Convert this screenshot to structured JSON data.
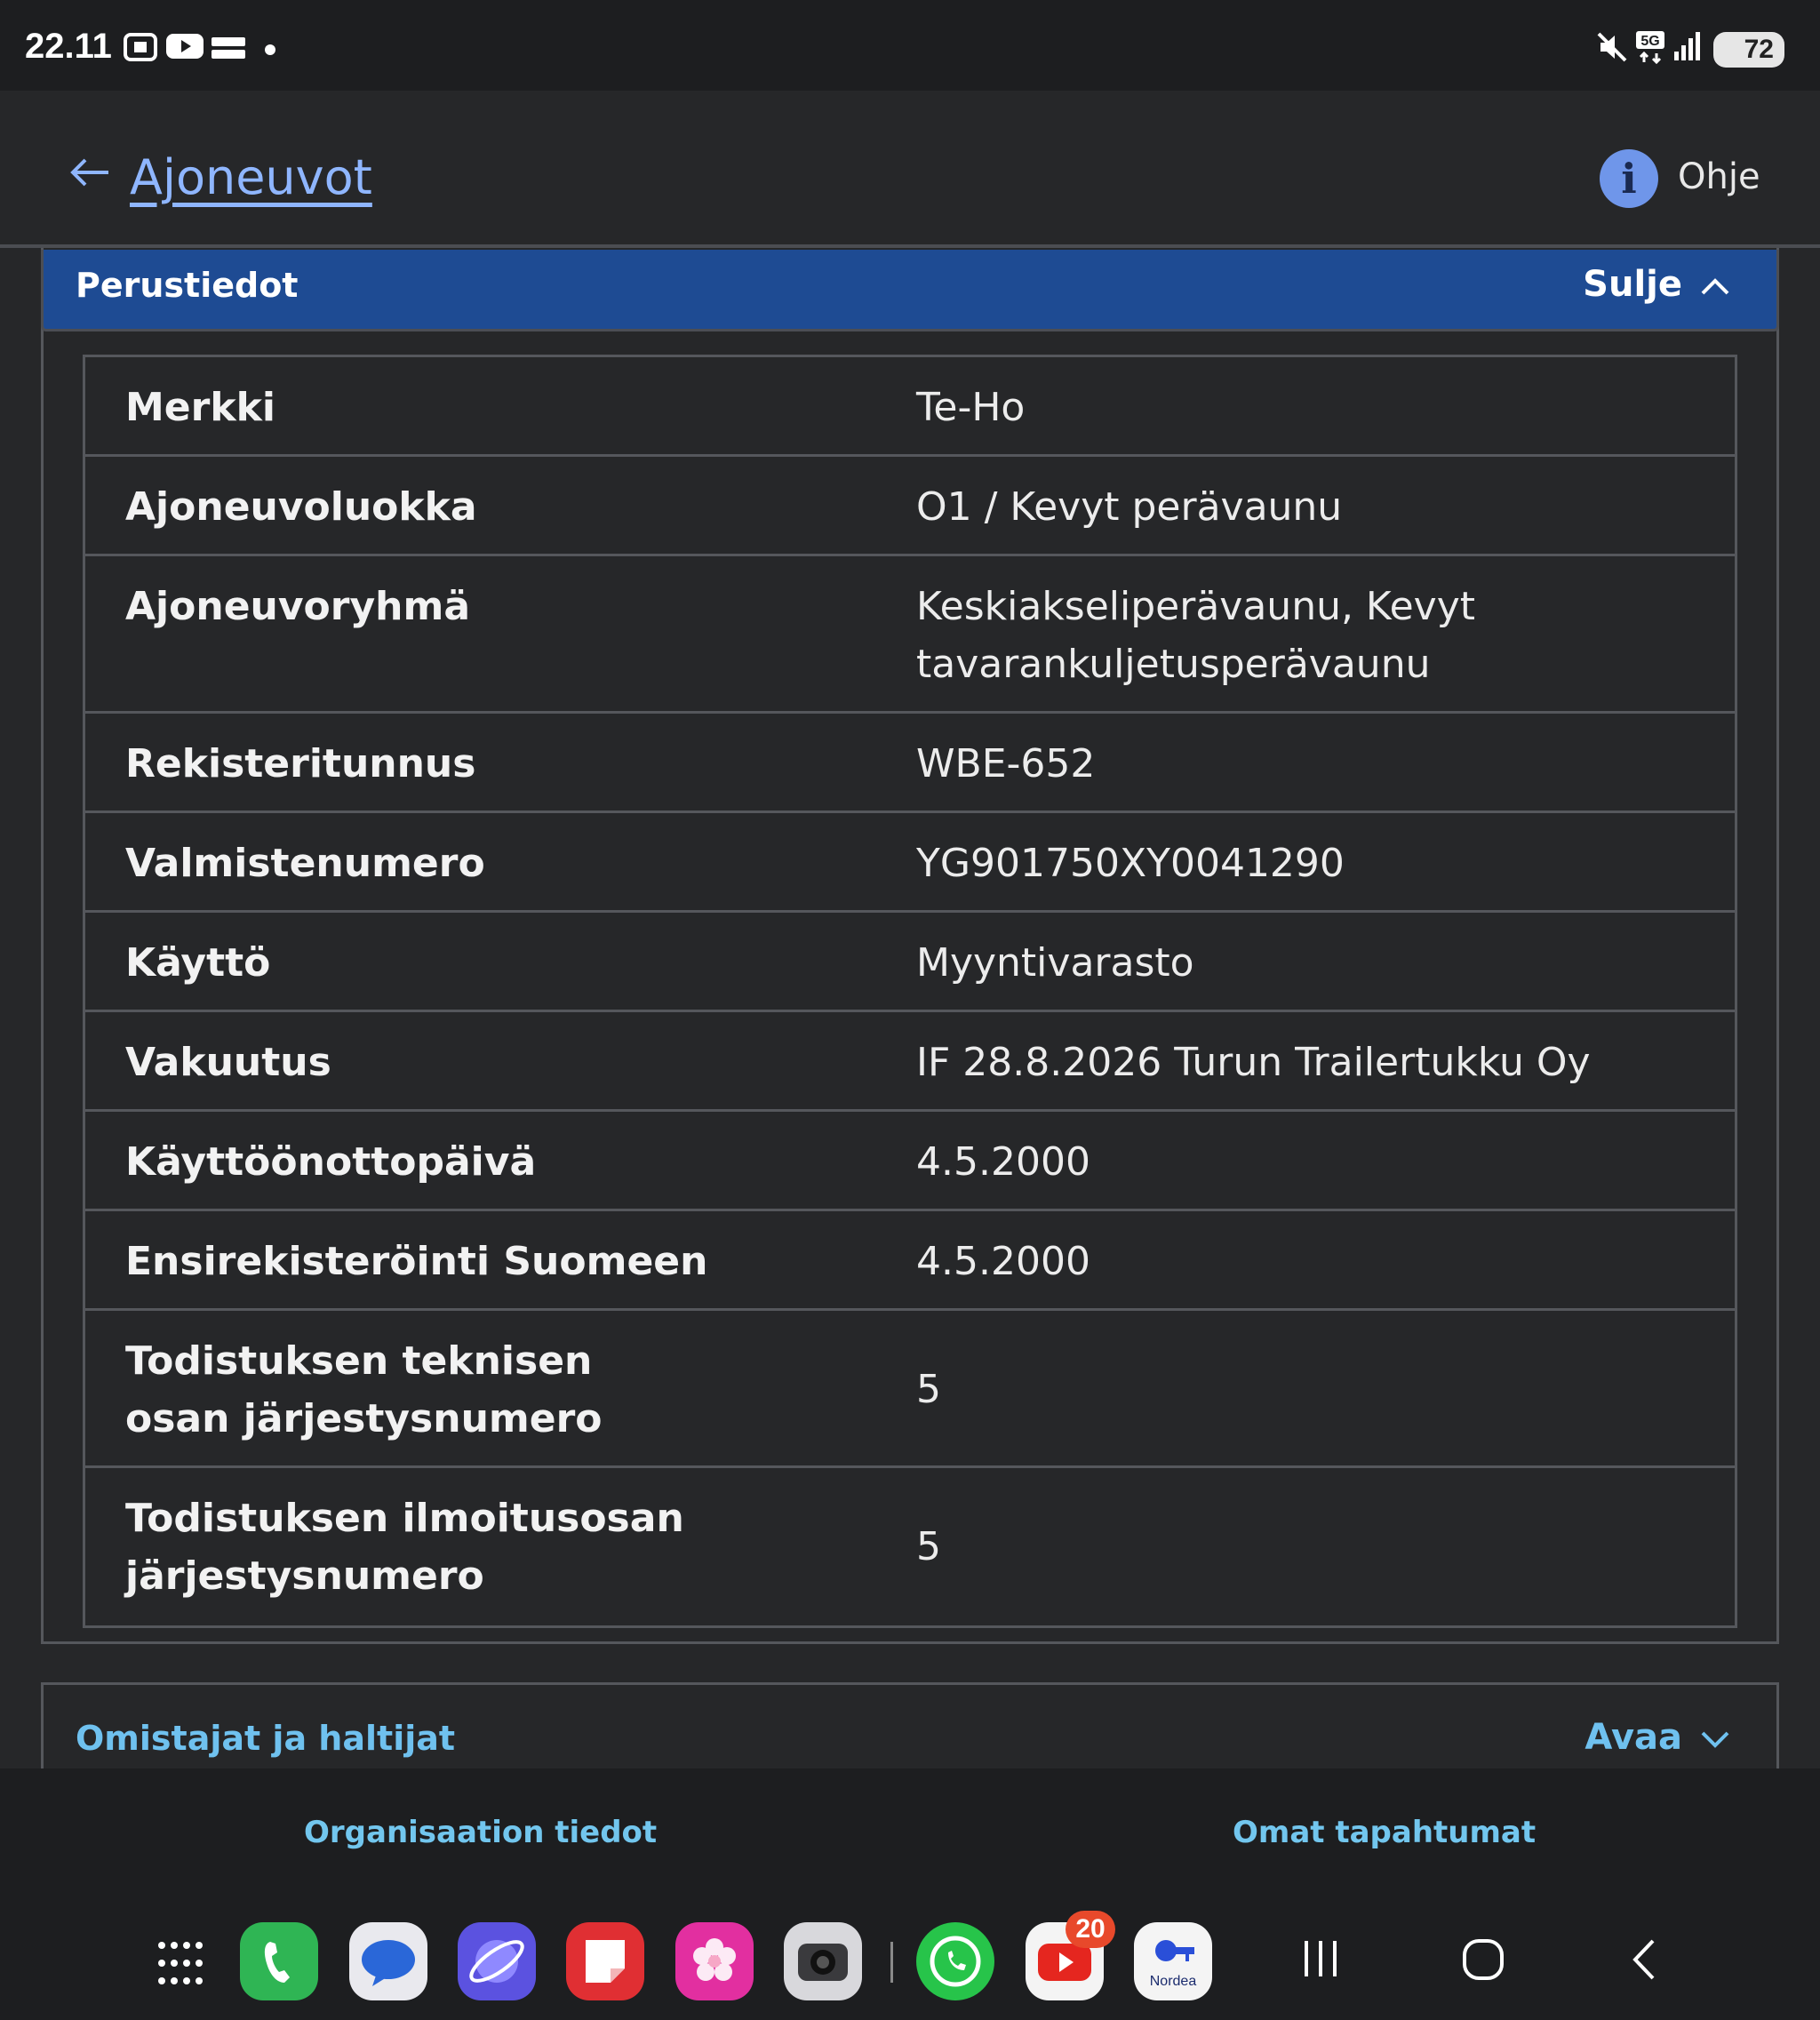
{
  "status_bar": {
    "time": "22.11",
    "battery": "72"
  },
  "header": {
    "back_label": "Ajoneuvot",
    "help_label": "Ohje",
    "help_icon_letter": "i"
  },
  "section_basic": {
    "title": "Perustiedot",
    "toggle_label": "Sulje",
    "rows": [
      {
        "label": "Merkki",
        "value": "Te-Ho"
      },
      {
        "label": "Ajoneuvoluokka",
        "value": "O1 / Kevyt perävaunu"
      },
      {
        "label": "Ajoneuvoryhmä",
        "value": "Keskiakseliperävaunu, Kevyt tavarankuljetusperävaunu"
      },
      {
        "label": "Rekisteritunnus",
        "value": "WBE-652"
      },
      {
        "label": "Valmistenumero",
        "value": "YG901750XY0041290"
      },
      {
        "label": "Käyttö",
        "value": "Myyntivarasto"
      },
      {
        "label": "Vakuutus",
        "value": "IF 28.8.2026 Turun Trailertukku Oy"
      },
      {
        "label": "Käyttöönottopäivä",
        "value": "4.5.2000"
      },
      {
        "label": "Ensirekisteröinti Suomeen",
        "value": "4.5.2000"
      },
      {
        "label": "Todistuksen teknisen osan järjestysnumero",
        "value": "5"
      },
      {
        "label": "Todistuksen ilmoitusosan järjestysnumero",
        "value": "5"
      }
    ]
  },
  "section_owners": {
    "title": "Omistajat ja haltijat",
    "toggle_label": "Avaa"
  },
  "bottom_nav": {
    "left": "Organisaation tiedot",
    "right": "Omat tapahtumat"
  },
  "dock": {
    "youtube_badge": "20",
    "nordea_label": "Nordea",
    "apps": [
      "apps-grid-icon",
      "phone-icon",
      "messages-icon",
      "internet-icon",
      "notes-icon",
      "gallery-icon",
      "camera-icon",
      "whatsapp-icon",
      "youtube-icon",
      "nordea-icon"
    ]
  },
  "colors": {
    "background": "#262729",
    "accordion_header": "#1e4b93",
    "link": "#8fb6ff",
    "accent_cyan": "#6fc1ef",
    "border": "#55575c"
  }
}
